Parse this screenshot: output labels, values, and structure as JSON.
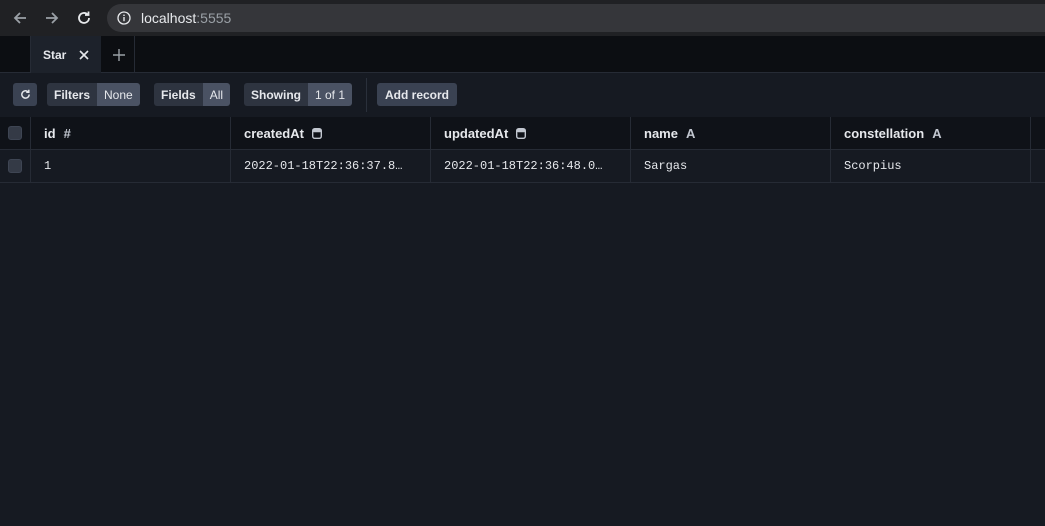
{
  "browser": {
    "url_host": "localhost",
    "url_port": ":5555"
  },
  "tabs": {
    "active": "Star"
  },
  "toolbar": {
    "filters_label": "Filters",
    "filters_value": "None",
    "fields_label": "Fields",
    "fields_value": "All",
    "showing_label": "Showing",
    "showing_value": "1 of 1",
    "add_record_label": "Add record"
  },
  "table": {
    "columns": [
      {
        "label": "id",
        "type": "#"
      },
      {
        "label": "createdAt",
        "type": "date-icon"
      },
      {
        "label": "updatedAt",
        "type": "date-icon"
      },
      {
        "label": "name",
        "type": "A"
      },
      {
        "label": "constellation",
        "type": "A"
      }
    ],
    "rows": [
      {
        "id": "1",
        "createdAt": "2022-01-18T22:36:37.8…",
        "updatedAt": "2022-01-18T22:36:48.0…",
        "name": "Sargas",
        "constellation": "Scorpius"
      }
    ]
  },
  "colors": {
    "background": "#161a22",
    "header": "#0f1218",
    "button": "#3a4252"
  }
}
